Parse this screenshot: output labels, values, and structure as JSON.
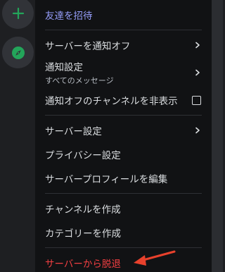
{
  "menu": {
    "invite": "友達を招待",
    "mute_server": "サーバーを通知オフ",
    "notification_settings": "通知設定",
    "notification_settings_sub": "すべてのメッセージ",
    "hide_muted_channels": "通知オフのチャンネルを非表示",
    "server_settings": "サーバー設定",
    "privacy_settings": "プライバシー設定",
    "edit_server_profile": "サーバープロフィールを編集",
    "create_channel": "チャンネルを作成",
    "create_category": "カテゴリーを作成",
    "leave_server": "サーバーから脱退"
  },
  "colors": {
    "invite": "#949cf7",
    "danger": "#f23f42",
    "green": "#23a55a",
    "menu_bg": "#111214",
    "annotation_arrow": "#e8412c"
  },
  "icons": {
    "add_server": "plus-icon",
    "explore": "compass-icon",
    "submenu": "chevron-right-icon",
    "checkbox": "checkbox-unchecked-icon"
  },
  "state": {
    "hide_muted_channels_checked": false
  }
}
